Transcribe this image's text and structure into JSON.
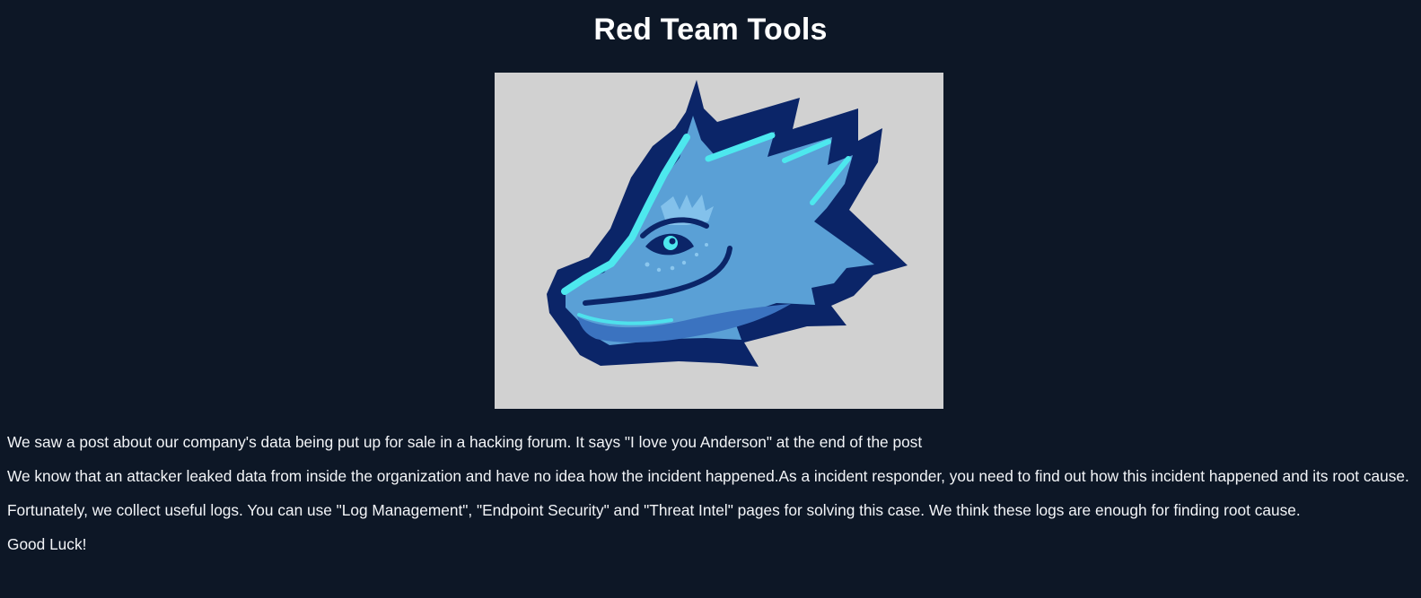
{
  "page": {
    "title": "Red Team Tools"
  },
  "hero_image": {
    "logo_icon": "dragon-head-icon",
    "colors": {
      "background": "#d1d1d1",
      "outline": "#0b2568",
      "main": "#5aa0d6",
      "highlight": "#4de8ee",
      "shade": "#3b73c0"
    }
  },
  "content": {
    "paragraphs": [
      "We saw a post about our company's data being put up for sale in a hacking forum. It says \"I love you Anderson\" at the end of the post",
      "We know that an attacker leaked data from inside the organization and have no idea how the incident happened.As a incident responder, you need to find out how this incident happened and its root cause.",
      "Fortunately, we collect useful logs. You can use \"Log Management\", \"Endpoint Security\" and \"Threat Intel\" pages for solving this case. We think these logs are enough for finding root cause.",
      "Good Luck!"
    ]
  },
  "theme": {
    "page_background": "#0d1726",
    "text_color": "#f3f5f8"
  }
}
